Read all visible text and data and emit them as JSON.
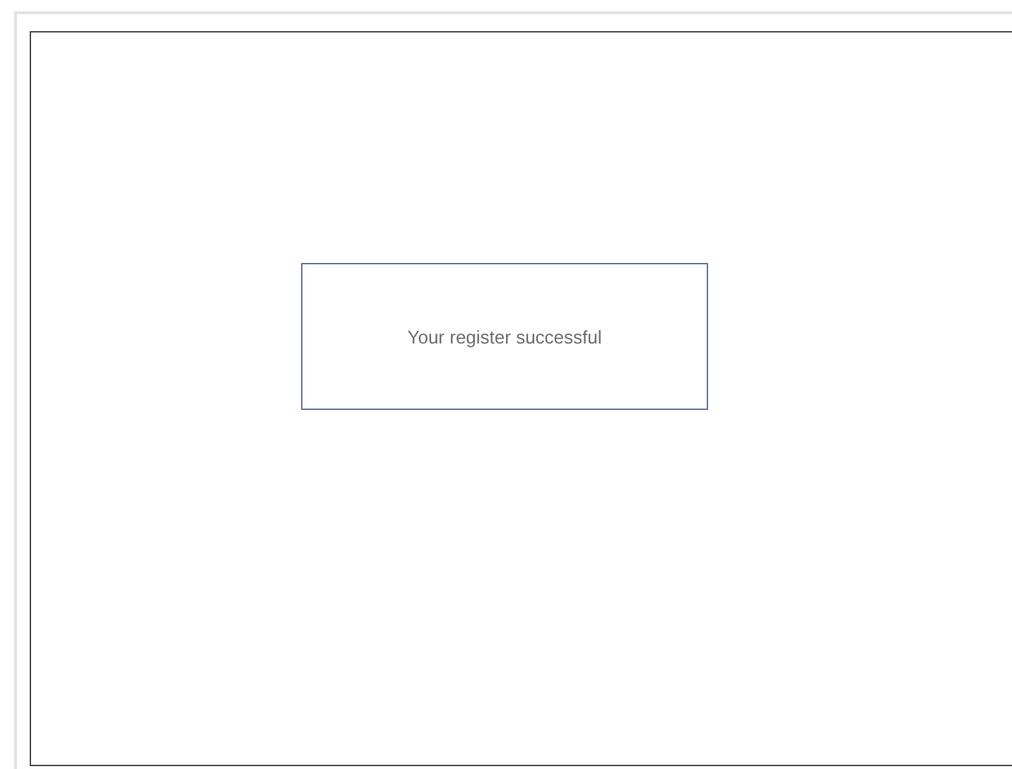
{
  "message_box": {
    "text": "Your register successful"
  }
}
